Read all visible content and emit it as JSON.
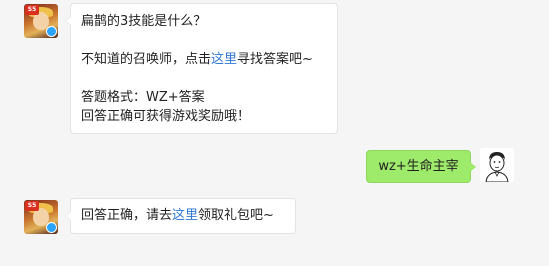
{
  "chat": {
    "msg1": {
      "question": "扁鹊的3技能是什么？",
      "hint_before": "不知道的召唤师，点击",
      "hint_link": "这里",
      "hint_after": "寻找答案吧~",
      "format": "答题格式：WZ+答案",
      "reward": "回答正确可获得游戏奖励哦！"
    },
    "user_reply": "wz+生命主宰",
    "msg2": {
      "before": "回答正确，请去",
      "link": "这里",
      "after": "领取礼包吧~"
    },
    "avatar_badge": "S5",
    "colors": {
      "user_bubble": "#9eea6a",
      "link": "#2f78d6",
      "background": "#f5f5f5"
    }
  }
}
